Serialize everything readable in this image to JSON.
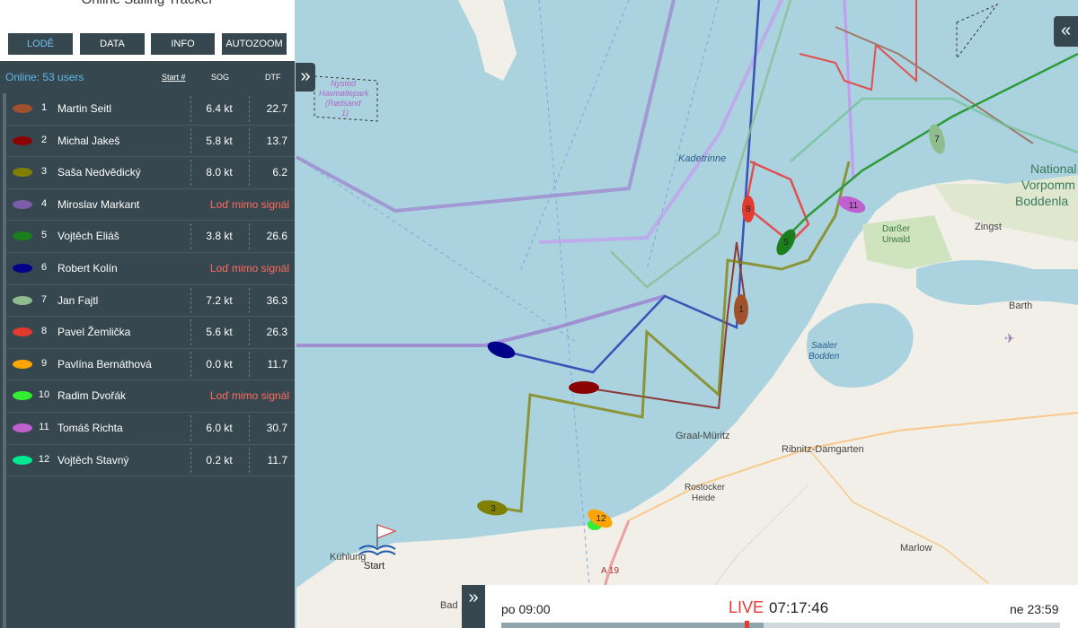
{
  "app_title": "Online Sailing Tracker",
  "toolbar": {
    "lode": "LODĚ",
    "data": "DATA",
    "info": "INFO",
    "autozoom": "AUTOZOOM"
  },
  "online_label": "Online: 53 users",
  "columns": {
    "start": "Start #",
    "sog": "SOG",
    "dtf": "DTF"
  },
  "collapse_glyph": "»",
  "expand_glyph": "«",
  "boats": [
    {
      "num": "1",
      "name": "Martin Seitl",
      "color": "#a0522d",
      "sog": "6.4 kt",
      "dtf": "22.7"
    },
    {
      "num": "2",
      "name": "Michal Jakeš",
      "color": "#8b0000",
      "sog": "5.8 kt",
      "dtf": "13.7"
    },
    {
      "num": "3",
      "name": "Saša Nedvědický",
      "color": "#808000",
      "sog": "8.0 kt",
      "dtf": "6.2"
    },
    {
      "num": "4",
      "name": "Miroslav Markant",
      "color": "#7b5ea7",
      "status": "Loď mimo signál"
    },
    {
      "num": "5",
      "name": "Vojtěch Eliáš",
      "color": "#1a7f1a",
      "sog": "3.8 kt",
      "dtf": "26.6"
    },
    {
      "num": "6",
      "name": "Robert Kolín",
      "color": "#00008b",
      "status": "Loď mimo signál"
    },
    {
      "num": "7",
      "name": "Jan Fajtl",
      "color": "#8fbc8f",
      "sog": "7.2 kt",
      "dtf": "36.3"
    },
    {
      "num": "8",
      "name": "Pavel Žemlička",
      "color": "#e23a2e",
      "sog": "5.6 kt",
      "dtf": "26.3"
    },
    {
      "num": "9",
      "name": "Pavlína Bernáthová",
      "color": "#ffa500",
      "sog": "0.0 kt",
      "dtf": "11.7"
    },
    {
      "num": "10",
      "name": "Radim Dvořák",
      "color": "#33ee33",
      "status": "Loď mimo signál"
    },
    {
      "num": "11",
      "name": "Tomáš Richta",
      "color": "#c060d0",
      "sog": "6.0 kt",
      "dtf": "30.7"
    },
    {
      "num": "12",
      "name": "Vojtěch Stavný",
      "color": "#00e890",
      "sog": "0.2 kt",
      "dtf": "11.7"
    }
  ],
  "map": {
    "labels": {
      "kadetrinne": "Kadetrinne",
      "national": "National",
      "vorpomm": "Vorpomm",
      "boddenl": "Boddenla",
      "zingst": "Zingst",
      "darsser1": "Darßer",
      "darsser2": "Urwald",
      "barth": "Barth",
      "saaler1": "Saaler",
      "saaler2": "Bodden",
      "graal": "Graal-Müritz",
      "ribnitz": "Ribnitz-Damgarten",
      "rostocker1": "Rostocker",
      "rostocker2": "Heide",
      "marlow": "Marlow",
      "kuhlung": "Kühlung",
      "bad": "Bad",
      "a19": "A 19",
      "start": "Start",
      "nysted1": "Nysted",
      "nysted2": "Havmøllepark",
      "nysted3": "(Rødsand",
      "nysted4": "1)"
    },
    "boat_numbers": [
      "1",
      "3",
      "5",
      "7",
      "8",
      "11",
      "12"
    ]
  },
  "timeline": {
    "start": "po 09:00",
    "live": "LIVE",
    "time": "07:17:46",
    "end": "ne 23:59",
    "progress": 0.47
  }
}
